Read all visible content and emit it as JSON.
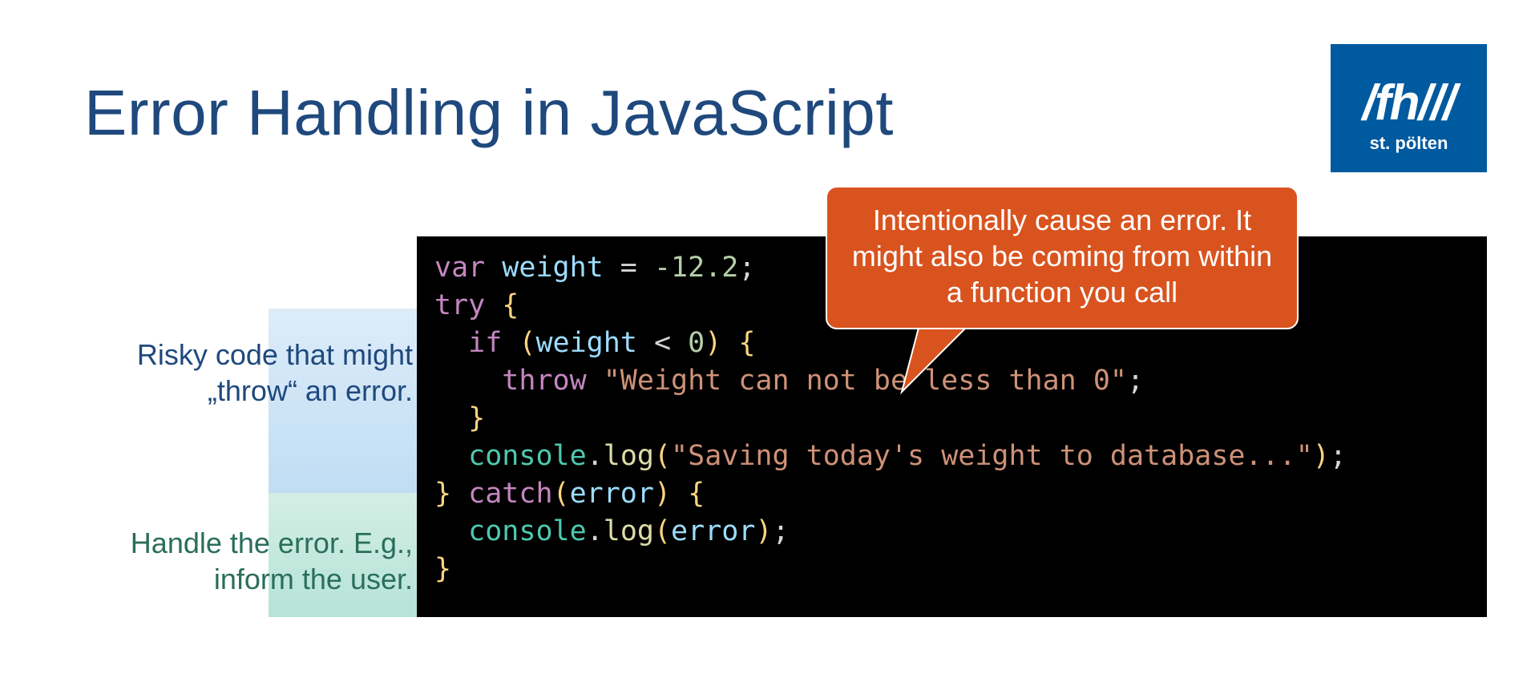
{
  "title": "Error Handling in JavaScript",
  "logo": {
    "main": "/fh///",
    "sub": "st. pölten"
  },
  "annotations": {
    "risky": "Risky code that might „throw“ an error.",
    "handle": "Handle the error. E.g., inform the user."
  },
  "callout": "Intentionally cause an error. It might also be coming from within a function you call",
  "code": {
    "l1": {
      "var": "var",
      "id": "weight",
      "eq": " = ",
      "num": "-12.2",
      "semi": ";"
    },
    "l2": {
      "try": "try",
      "brace": " {"
    },
    "l3": {
      "indent": "  ",
      "if": "if",
      "open": " (",
      "id": "weight",
      "op": " < ",
      "num": "0",
      "close": ") {"
    },
    "l4": {
      "indent": "    ",
      "throw": "throw",
      "sp": " ",
      "str": "\"Weight can not be less than 0\"",
      "semi": ";"
    },
    "l5": {
      "indent": "  ",
      "brace": "}"
    },
    "l6": {
      "indent": "  ",
      "obj": "console",
      "dot": ".",
      "fn": "log",
      "open": "(",
      "str": "\"Saving today's weight to database...\"",
      "close": ")",
      "semi": ";"
    },
    "l7": {
      "close": "}",
      "sp": " ",
      "catch": "catch",
      "open": "(",
      "id": "error",
      "close2": ") {"
    },
    "l8": {
      "indent": "  ",
      "obj": "console",
      "dot": ".",
      "fn": "log",
      "open": "(",
      "id": "error",
      "close": ")",
      "semi": ";"
    },
    "l9": {
      "brace": "}"
    }
  }
}
